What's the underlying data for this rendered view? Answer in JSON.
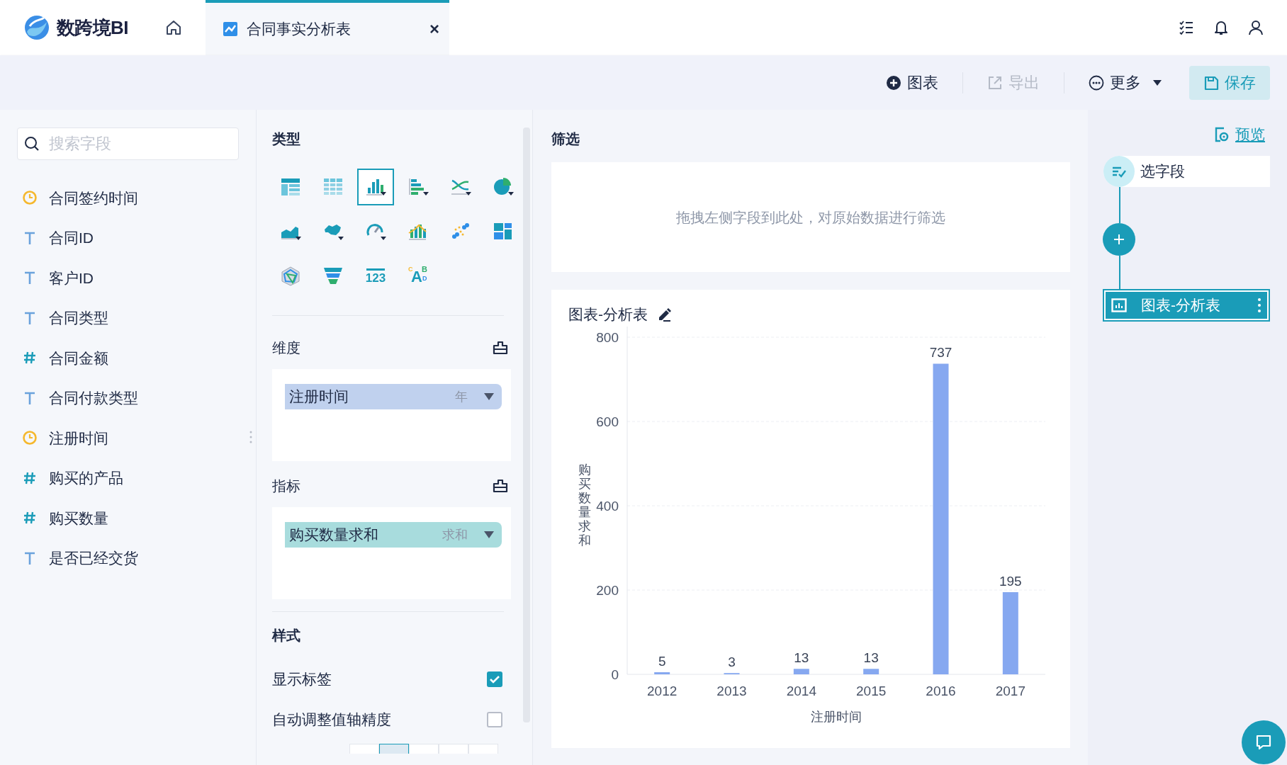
{
  "header": {
    "logo_text": "数跨境BI",
    "tabs": [
      {
        "label": "合同事实分析表",
        "selected": true,
        "close": "×"
      }
    ]
  },
  "toolbar": {
    "buttons": [
      {
        "label": "图表",
        "kind": "add",
        "disabled": false
      },
      {
        "label": "导出",
        "kind": "export",
        "disabled": true
      },
      {
        "label": "更多",
        "kind": "more",
        "disabled": false
      },
      {
        "label": "保存",
        "kind": "save",
        "disabled": false
      }
    ]
  },
  "fields": {
    "placeholder": "搜索字段",
    "items": [
      {
        "label": "合同签约时间",
        "kind": "date"
      },
      {
        "label": "合同ID",
        "kind": "text"
      },
      {
        "label": "客户ID",
        "kind": "text"
      },
      {
        "label": "合同类型",
        "kind": "text"
      },
      {
        "label": "合同金额",
        "kind": "number"
      },
      {
        "label": "合同付款类型",
        "kind": "text"
      },
      {
        "label": "注册时间",
        "kind": "date"
      },
      {
        "label": "购买的产品",
        "kind": "number"
      },
      {
        "label": "购买数量",
        "kind": "number"
      },
      {
        "label": "是否已经交货",
        "kind": "text"
      }
    ]
  },
  "chart_types": {
    "title": "类型",
    "items": [
      {
        "kind": "table",
        "selected": false
      },
      {
        "kind": "crosstable",
        "selected": false
      },
      {
        "kind": "bar",
        "selected": true
      },
      {
        "kind": "hbar",
        "selected": false
      },
      {
        "kind": "line",
        "selected": false
      },
      {
        "kind": "pie",
        "selected": false
      },
      {
        "kind": "area",
        "selected": false
      },
      {
        "kind": "map",
        "selected": false
      },
      {
        "kind": "gauge",
        "selected": false
      },
      {
        "kind": "combo",
        "selected": false
      },
      {
        "kind": "scatter",
        "selected": false
      },
      {
        "kind": "treemap",
        "selected": false
      },
      {
        "kind": "radar",
        "selected": false
      },
      {
        "kind": "funnel",
        "selected": false
      },
      {
        "kind": "number",
        "selected": false,
        "glyphs": [
          "123"
        ]
      },
      {
        "kind": "wordcloud",
        "selected": false,
        "glyphs": [
          "C",
          "A",
          "B",
          "D"
        ]
      }
    ]
  },
  "dimension": {
    "title": "维度",
    "pill": {
      "label": "注册时间",
      "aggregation": "年"
    }
  },
  "measure": {
    "title": "指标",
    "pill": {
      "label": "购买数量求和",
      "aggregation": "求和"
    }
  },
  "style": {
    "title": "样式",
    "options": [
      {
        "label": "显示标签",
        "checked": true
      },
      {
        "label": "自动调整值轴精度",
        "checked": false
      }
    ],
    "alignment": [
      {
        "selected": false
      },
      {
        "selected": true
      },
      {
        "selected": false
      },
      {
        "selected": false
      },
      {
        "selected": false
      }
    ]
  },
  "filter": {
    "title": "筛选",
    "hint": "拖拽左侧字段到此处，对原始数据进行筛选"
  },
  "chart": {
    "title": "图表-分析表",
    "chart_data": {
      "type": "bar",
      "xlabel": "注册时间",
      "ylabel": "购买数量求和",
      "categories": [
        "2012",
        "2013",
        "2014",
        "2015",
        "2016",
        "2017"
      ],
      "series": [
        {
          "color": "#86a8f0",
          "values": [
            5,
            3,
            13,
            13,
            737,
            195
          ]
        }
      ],
      "ylim": [
        0,
        800
      ],
      "yticks": [
        0,
        200,
        400,
        600,
        800
      ],
      "grid": true,
      "data_labels": true
    }
  },
  "flow": {
    "preview": "预览",
    "nodes": [
      {
        "kind": "step",
        "label": "选字段",
        "selected": false
      },
      {
        "kind": "add"
      },
      {
        "kind": "chart",
        "label": "图表-分析表",
        "selected": true
      }
    ]
  }
}
